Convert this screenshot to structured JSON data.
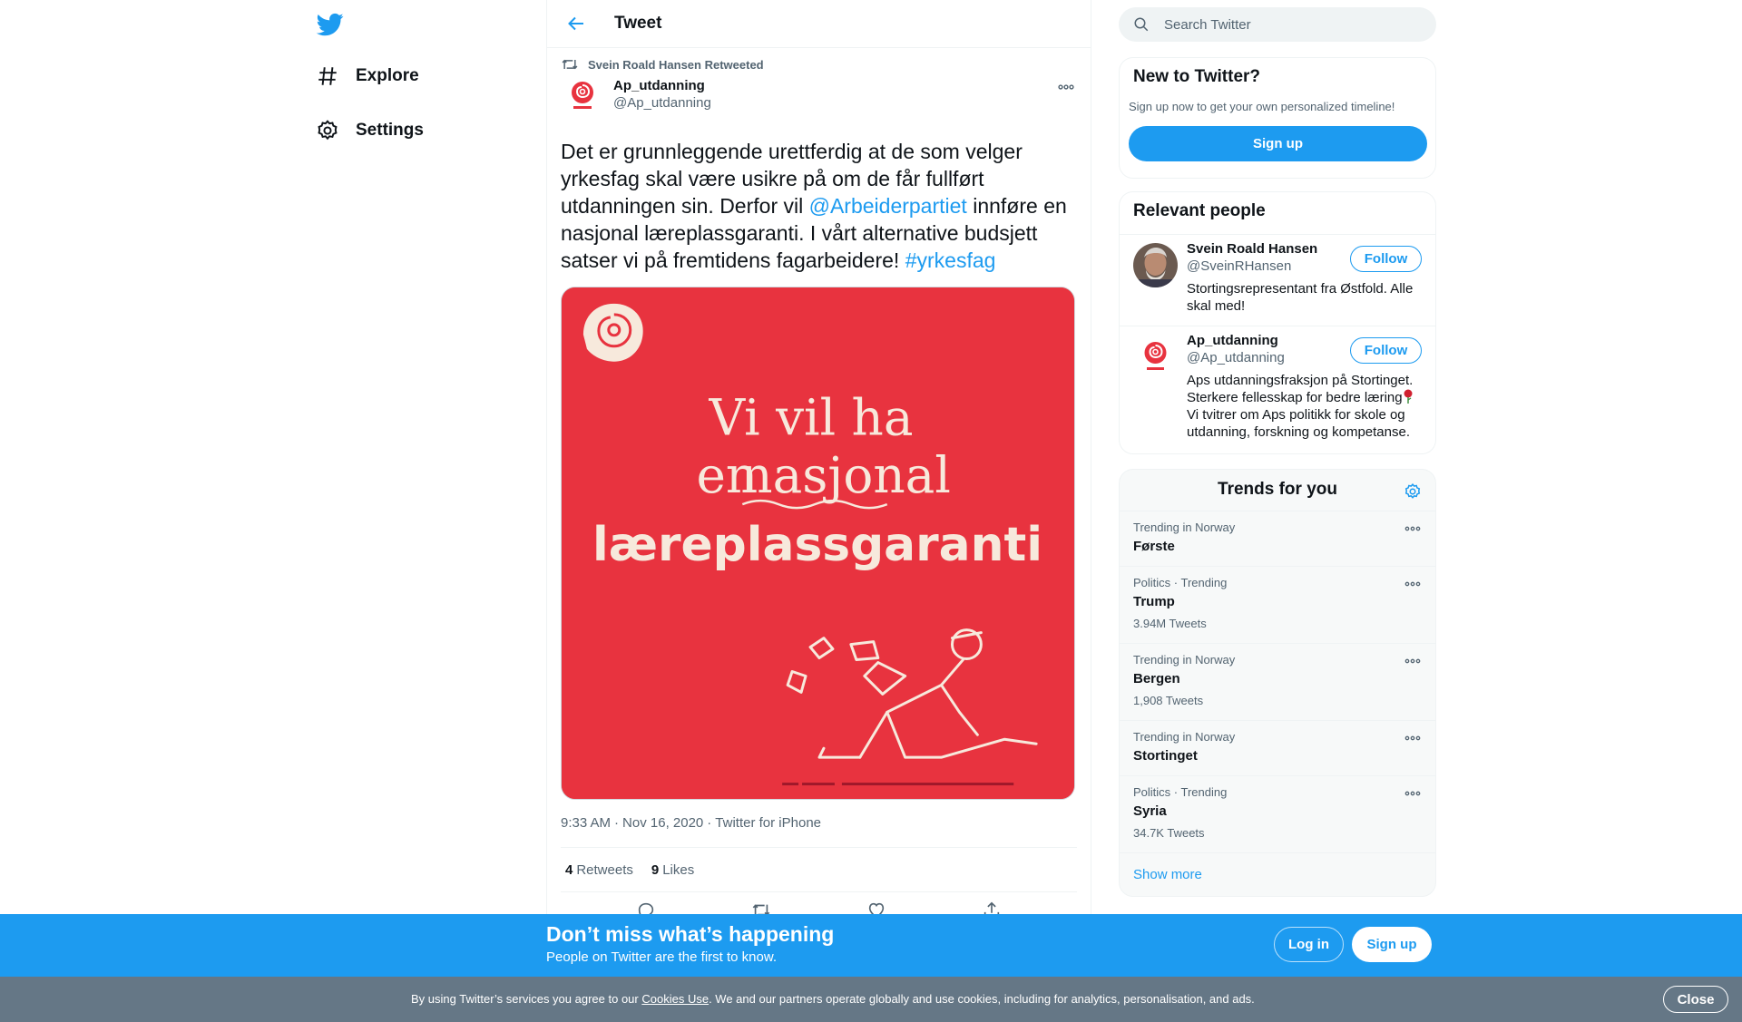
{
  "nav": {
    "explore_label": "Explore",
    "settings_label": "Settings"
  },
  "header": {
    "title": "Tweet"
  },
  "tweet": {
    "retweeted_by": "Svein Roald Hansen Retweeted",
    "author_name": "Ap_utdanning",
    "author_handle": "@Ap_utdanning",
    "text_part1": "Det er grunnleggende urettferdig at de som velger yrkesfag skal være usikre på om de får fullført utdanningen sin. Derfor vil ",
    "mention": "@Arbeiderpartiet",
    "text_part2": " innføre en nasjonal læreplassgaranti. I vårt alternative budsjett satser vi på fremtidens fagarbeidere! ",
    "hashtag": "#yrkesfag",
    "image_text_line1": "Vi vil ha",
    "image_text_line2_a": "en",
    "image_text_line2_b": "nasjonal",
    "image_text_line3": "læreplassgaranti",
    "time": "9:33 AM",
    "date": "Nov 16, 2020",
    "source": "Twitter for iPhone",
    "separator": "·",
    "retweets_count": "4",
    "retweets_label": "Retweets",
    "likes_count": "9",
    "likes_label": "Likes"
  },
  "search": {
    "placeholder": "Search Twitter"
  },
  "new_to_twitter": {
    "title": "New to Twitter?",
    "subtitle": "Sign up now to get your own personalized timeline!",
    "signup_label": "Sign up"
  },
  "relevant_people": {
    "title": "Relevant people",
    "follow_label": "Follow",
    "people": [
      {
        "name": "Svein Roald Hansen",
        "handle": "@SveinRHansen",
        "bio": "Stortingsrepresentant fra Østfold. Alle skal med!"
      },
      {
        "name": "Ap_utdanning",
        "handle": "@Ap_utdanning",
        "bio": "Aps utdanningsfraksjon på Stortinget. Sterkere fellesskap for bedre læring",
        "bio2": "Vi tvitrer om Aps politikk for skole og utdanning, forskning og kompetanse."
      }
    ]
  },
  "trends": {
    "title": "Trends for you",
    "items": [
      {
        "context": "Trending in Norway",
        "name": "Første",
        "count": ""
      },
      {
        "context": "Politics · Trending",
        "name": "Trump",
        "count": "3.94M Tweets"
      },
      {
        "context": "Trending in Norway",
        "name": "Bergen",
        "count": "1,908 Tweets"
      },
      {
        "context": "Trending in Norway",
        "name": "Stortinget",
        "count": ""
      },
      {
        "context": "Politics · Trending",
        "name": "Syria",
        "count": "34.7K Tweets"
      }
    ],
    "show_more": "Show more"
  },
  "banner": {
    "title": "Don’t miss what’s happening",
    "subtitle": "People on Twitter are the first to know.",
    "login_label": "Log in",
    "signup_label": "Sign up"
  },
  "cookie": {
    "text_before": "By using Twitter’s services you agree to our ",
    "link": "Cookies Use",
    "text_after": ". We and our partners operate globally and use cookies, including for analytics, personalisation, and ads.",
    "close_label": "Close"
  },
  "colors": {
    "accent": "#1d9bf0",
    "image_bg": "#e8333f",
    "cookie_bg": "#657786"
  }
}
